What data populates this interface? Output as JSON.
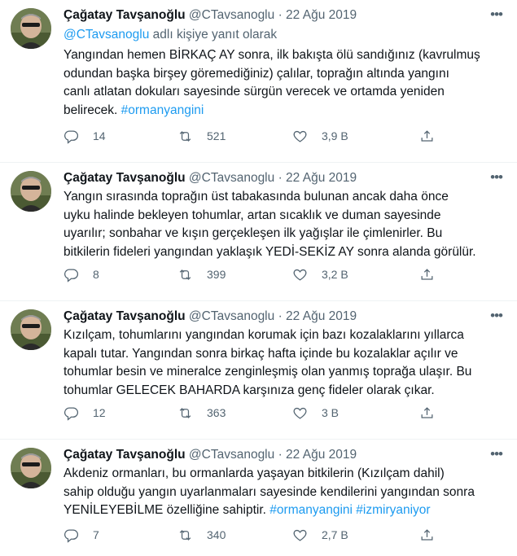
{
  "author": {
    "name": "Çağatay Tavşanoğlu",
    "handle": "@CTavsanoglu",
    "date": "22 Ağu 2019"
  },
  "more_icon": "more-horizontal-icon",
  "tweets": [
    {
      "reply_to_handle": "@CTavsanoglu",
      "reply_to_suffix": "adlı kişiye yanıt olarak",
      "lines": [
        "Yangından hemen BİRKAÇ AY sonra, ilk bakışta ölü sandığınız (kavrulmuş",
        "odundan başka birşey göremediğiniz) çalılar, toprağın altında yangını",
        "canlı atlatan dokuları sayesinde sürgün verecek ve ortamda yeniden"
      ],
      "last_line_text": "belirecek.",
      "hashtags": [
        "#ormanyangini"
      ],
      "replies": "14",
      "retweets": "521",
      "likes": "3,9 B"
    },
    {
      "lines": [
        "Yangın sırasında toprağın üst tabakasında bulunan ancak daha önce",
        "uyku halinde bekleyen tohumlar, artan sıcaklık ve duman sayesinde",
        "uyarılır; sonbahar ve kışın gerçekleşen ilk yağışlar ile çimlenirler. Bu",
        "bitkilerin fideleri yangından yaklaşık YEDİ-SEKİZ AY sonra alanda görülür."
      ],
      "replies": "8",
      "retweets": "399",
      "likes": "3,2 B"
    },
    {
      "lines": [
        "Kızılçam, tohumlarını yangından korumak için bazı kozalaklarını yıllarca",
        "kapalı tutar. Yangından sonra birkaç hafta içinde bu kozalaklar açılır ve",
        "tohumlar besin ve mineralce zenginleşmiş olan yanmış toprağa ulaşır. Bu",
        "tohumlar GELECEK BAHARDA karşınıza genç fideler olarak çıkar."
      ],
      "replies": "12",
      "retweets": "363",
      "likes": "3 B"
    },
    {
      "lines": [
        "Akdeniz ormanları, bu ormanlarda yaşayan bitkilerin (Kızılçam dahil)",
        "sahip olduğu yangın uyarlanmaları sayesinde kendilerini yangından sonra"
      ],
      "last_line_text": "YENİLEYEBİLME özelliğine sahiptir.",
      "hashtags": [
        "#ormanyangini",
        "#izmiryaniyor"
      ],
      "replies": "7",
      "retweets": "340",
      "likes": "2,7 B"
    }
  ],
  "icons": {
    "reply": "reply-icon",
    "retweet": "retweet-icon",
    "like": "like-heart-icon",
    "share": "share-icon"
  },
  "colors": {
    "link": "#1d9bf0",
    "text": "#0f1419",
    "secondary": "#536471"
  }
}
